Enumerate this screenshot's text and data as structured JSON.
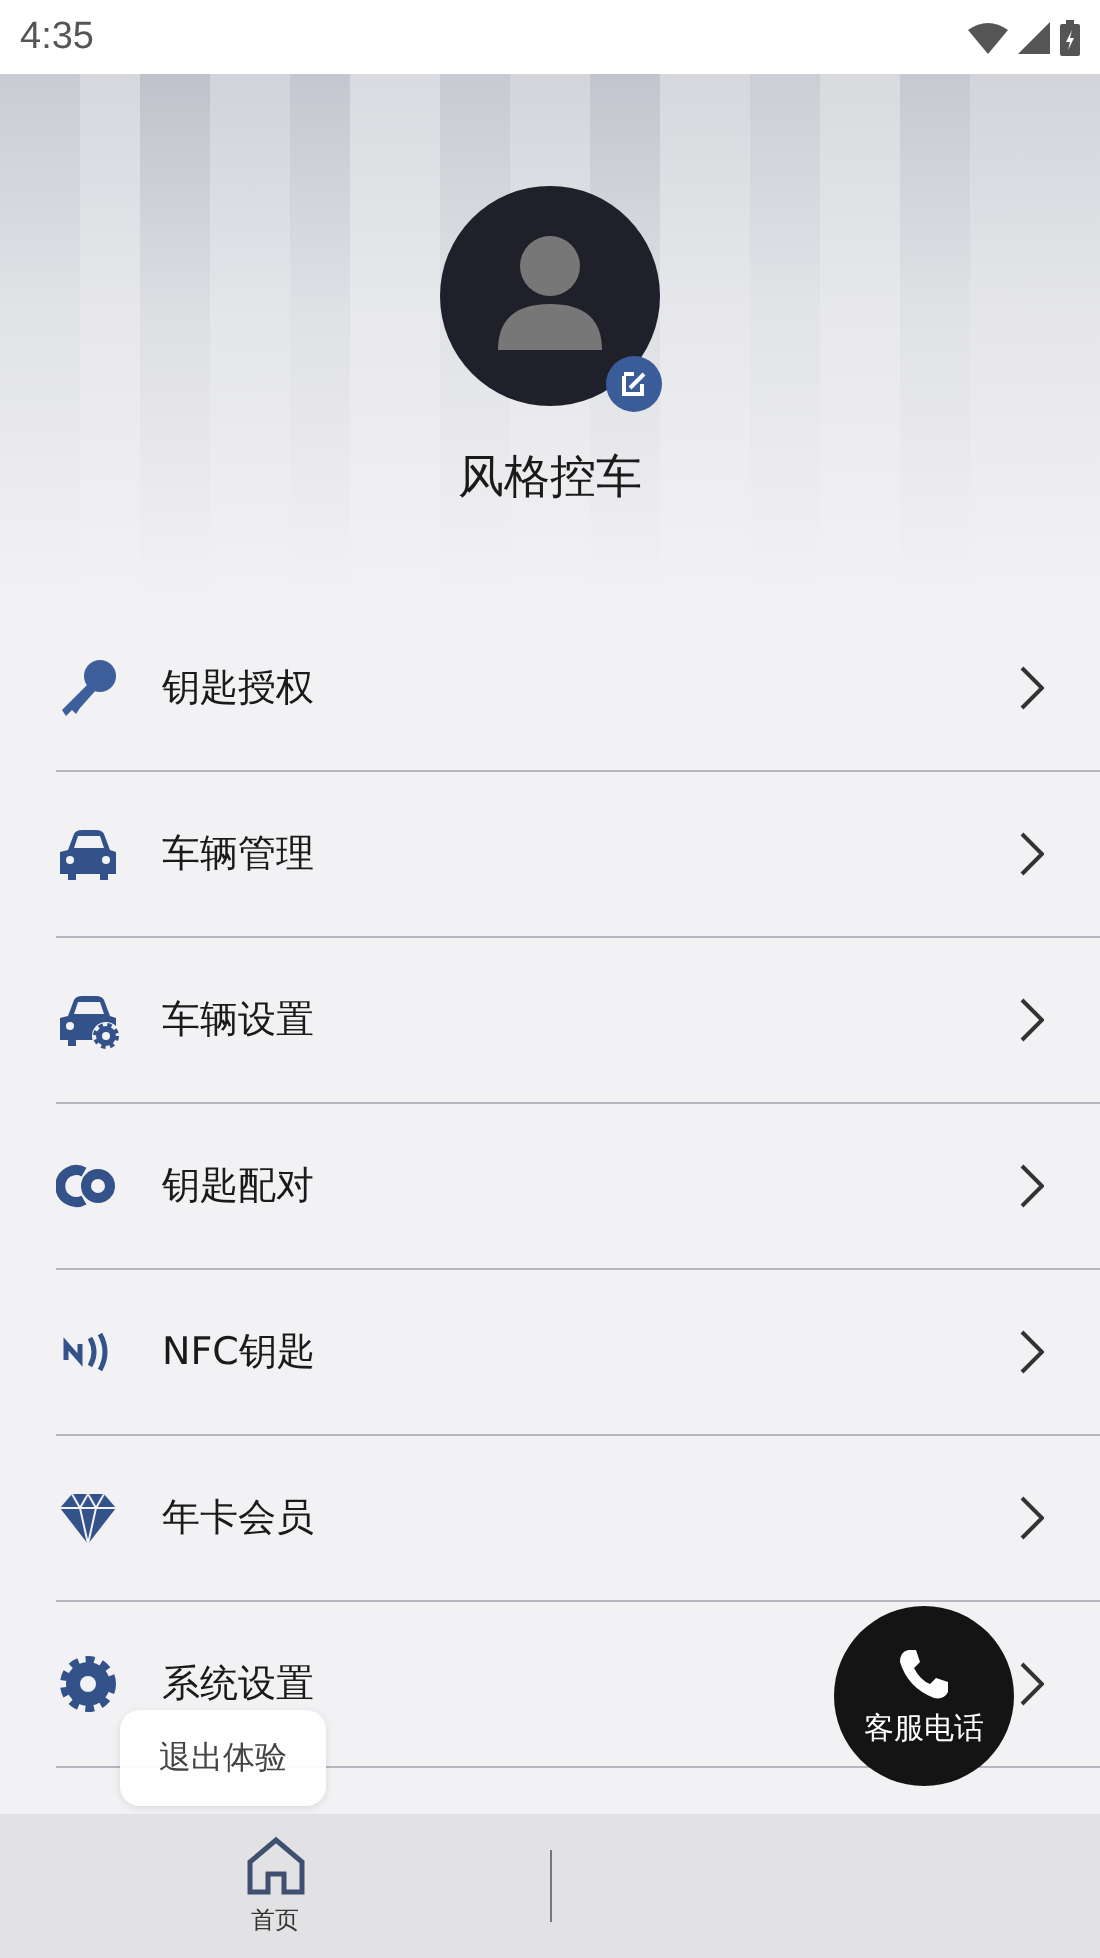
{
  "status_bar": {
    "time": "4:35"
  },
  "profile": {
    "name": "风格控车"
  },
  "menu": [
    {
      "label": "钥匙授权",
      "kind": "key"
    },
    {
      "label": "车辆管理",
      "kind": "car"
    },
    {
      "label": "车辆设置",
      "kind": "car-gear"
    },
    {
      "label": "钥匙配对",
      "kind": "pair"
    },
    {
      "label": "NFC钥匙",
      "kind": "nfc"
    },
    {
      "label": "年卡会员",
      "kind": "diamond"
    },
    {
      "label": "系统设置",
      "kind": "gear"
    }
  ],
  "toast": "退出体验",
  "call_button": {
    "label": "客服电话"
  },
  "bottom_nav": [
    {
      "label": "首页",
      "selected": true
    }
  ]
}
